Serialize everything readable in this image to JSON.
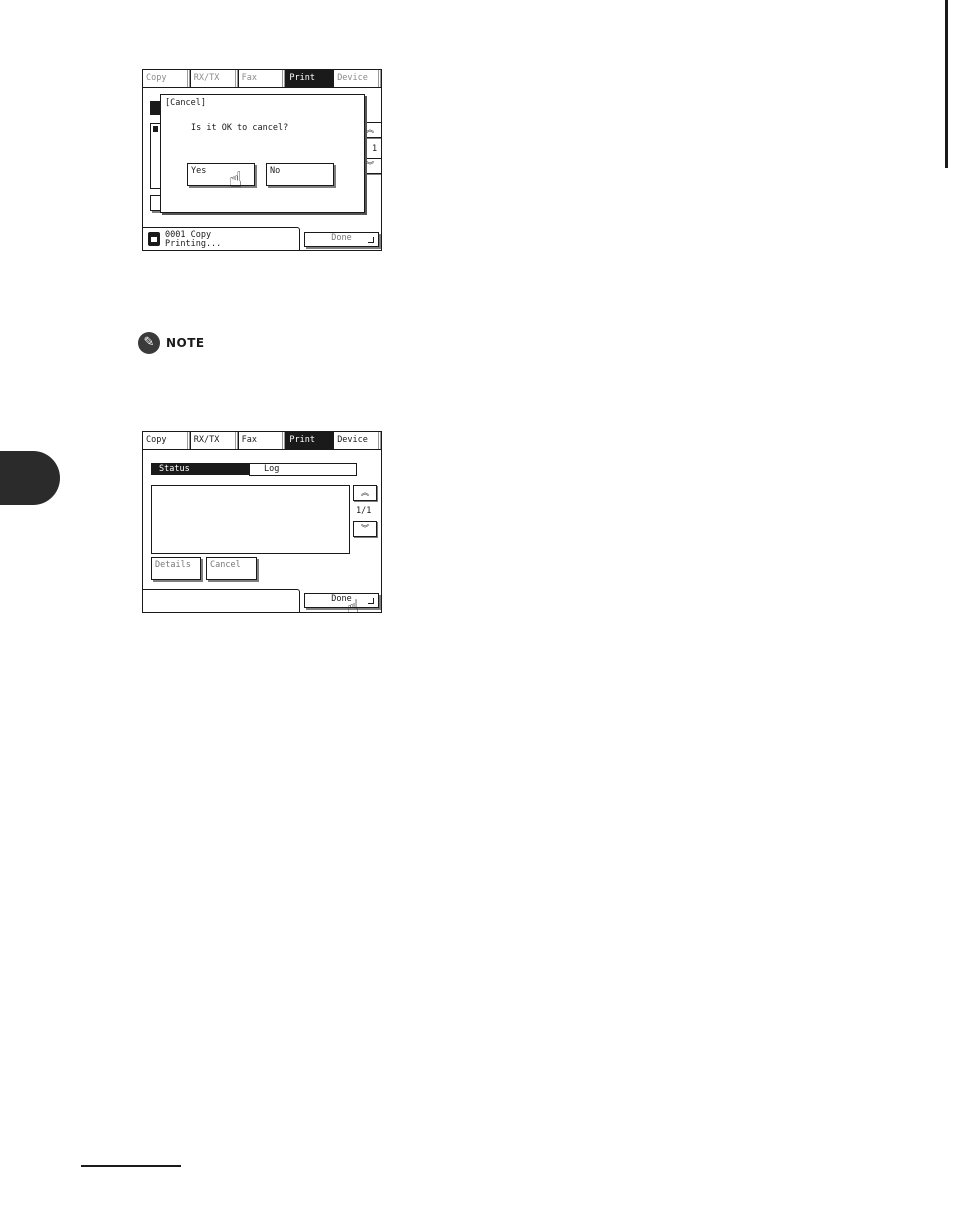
{
  "screen1": {
    "tabs": [
      "Copy",
      "RX/TX",
      "Fax",
      "Print",
      "Device"
    ],
    "active_tab": "Print",
    "dialog": {
      "title": "[Cancel]",
      "message": "Is it OK to cancel?",
      "yes_label": "Yes",
      "no_label": "No"
    },
    "page_fragment": "1",
    "done_label": "Done",
    "status": {
      "line1": "0001   Copy",
      "line2": "Printing..."
    }
  },
  "note": {
    "label": "NOTE"
  },
  "screen2": {
    "tabs": [
      "Copy",
      "RX/TX",
      "Fax",
      "Print",
      "Device"
    ],
    "active_tab": "Print",
    "subtabs": {
      "status_label": "Status",
      "log_label": "Log"
    },
    "page_indicator": "1/1",
    "details_label": "Details",
    "cancel_label": "Cancel",
    "done_label": "Done"
  },
  "icons": {
    "up": "double-up-chevron",
    "down": "double-down-chevron",
    "pointer": "pointing-hand",
    "note": "pencil-note-icon",
    "printer": "printer-status-icon"
  },
  "colors": {
    "ink": "#1a1a1a",
    "shadow": "#7f7f7f",
    "background": "#ffffff"
  }
}
